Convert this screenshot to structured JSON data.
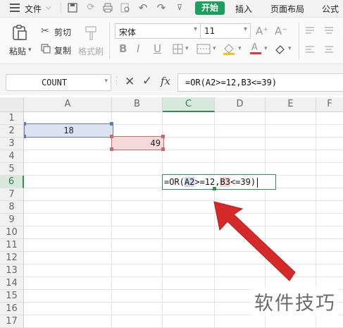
{
  "menubar": {
    "file_label": "文件",
    "tabs": [
      "开始",
      "插入",
      "页面布局",
      "公式"
    ]
  },
  "ribbon": {
    "paste_label": "粘贴",
    "cut_label": "剪切",
    "copy_label": "复制",
    "format_painter_label": "格式刷",
    "font_name": "宋体",
    "font_size": "11",
    "bold": "B",
    "italic": "I",
    "underline": "U",
    "grow_font": "A⁺",
    "shrink_font": "A⁻"
  },
  "formula_bar": {
    "name_box": "COUNT",
    "fx_label": "fx",
    "formula": "=OR(A2>=12,B3<=39)"
  },
  "grid": {
    "columns": [
      "A",
      "B",
      "C",
      "D",
      "E",
      "F"
    ],
    "rows": [
      "1",
      "2",
      "3",
      "4",
      "5",
      "6",
      "7",
      "8",
      "9",
      "10",
      "11",
      "12",
      "13",
      "14",
      "15",
      "16",
      "17"
    ],
    "active_column": "C",
    "active_row": "6",
    "cells": {
      "A2": "18",
      "B3": "49"
    },
    "edit_cell": {
      "prefix": "=OR(",
      "ref1": "A2",
      "mid": ">=12,",
      "ref2": "B3",
      "suffix": "<=39)"
    }
  },
  "colors": {
    "accent_green": "#1aa05a",
    "ref_blue": "#5d7cb8",
    "ref_red": "#c86a6a",
    "arrow_red": "#d42a2a"
  },
  "watermark": "软件技巧"
}
